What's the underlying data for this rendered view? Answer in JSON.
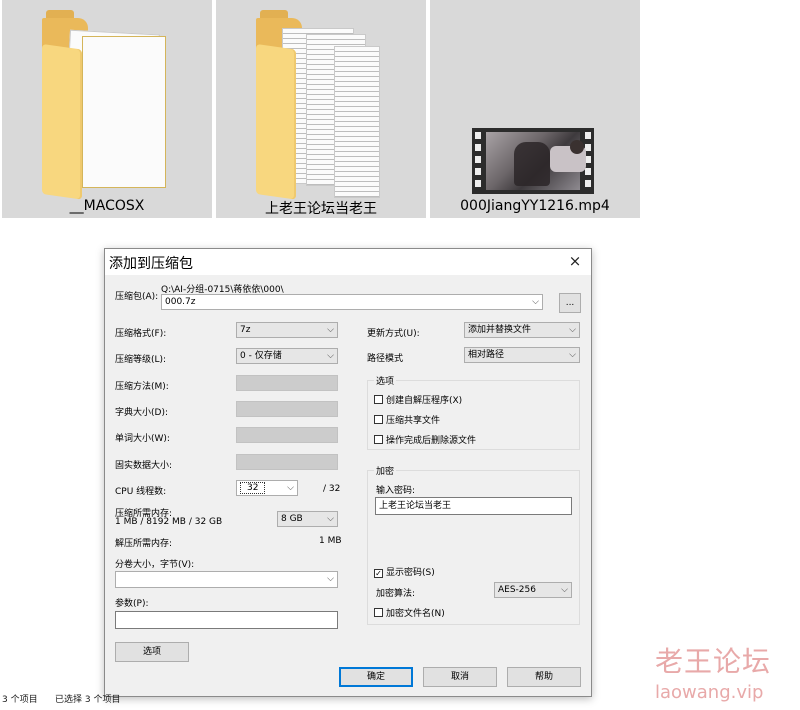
{
  "files": [
    {
      "name": "__MACOSX",
      "type": "folder"
    },
    {
      "name": "上老王论坛当老王",
      "type": "folder"
    },
    {
      "name": "000JiangYY1216.mp4",
      "type": "video"
    }
  ],
  "dialog": {
    "title": "添加到压缩包",
    "close": "×",
    "archive_label": "压缩包(A):",
    "archive_path": "Q:\\AI-分组-0715\\蒋依依\\000\\",
    "archive_name": "000.7z",
    "browse": "...",
    "left": {
      "format_label": "压缩格式(F):",
      "format_value": "7z",
      "level_label": "压缩等级(L):",
      "level_value": "0 - 仅存储",
      "method_label": "压缩方法(M):",
      "dict_label": "字典大小(D):",
      "word_label": "单词大小(W):",
      "solid_label": "固实数据大小:",
      "cpu_label": "CPU 线程数:",
      "cpu_value": "32",
      "cpu_total": "/ 32",
      "mem_label": "压缩所需内存:",
      "mem_detail": "1 MB / 8192 MB / 32 GB",
      "mem_value": "8 GB",
      "decomp_label": "解压所需内存:",
      "decomp_value": "1 MB",
      "split_label": "分卷大小，字节(V):",
      "params_label": "参数(P):",
      "options_button": "选项"
    },
    "right": {
      "update_label": "更新方式(U):",
      "update_value": "添加并替换文件",
      "path_label": "路径模式",
      "path_value": "相对路径",
      "options_title": "选项",
      "sfx": "创建自解压程序(X)",
      "shared": "压缩共享文件",
      "delete": "操作完成后删除源文件",
      "encrypt_title": "加密",
      "password_label": "输入密码:",
      "password_value": "上老王论坛当老王",
      "show_password": "显示密码(S)",
      "algo_label": "加密算法:",
      "algo_value": "AES-256",
      "encrypt_names": "加密文件名(N)"
    },
    "buttons": {
      "ok": "确定",
      "cancel": "取消",
      "help": "帮助"
    }
  },
  "status": {
    "items": "3 个项目",
    "selected": "已选择 3 个项目"
  },
  "watermark": {
    "cn": "老王论坛",
    "en": "laowang.vip"
  }
}
